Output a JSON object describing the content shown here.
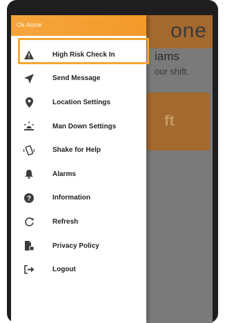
{
  "app": {
    "title_partial": "one",
    "heading_partial": "iams",
    "subtitle_partial": "our shift.",
    "button_partial": "ft"
  },
  "drawer": {
    "header_title": "Ok Alone",
    "items": [
      {
        "label": "High Risk Check In",
        "icon": "warning-icon",
        "selected": true
      },
      {
        "label": "Send Message",
        "icon": "send-icon"
      },
      {
        "label": "Location Settings",
        "icon": "location-pin-icon"
      },
      {
        "label": "Man Down Settings",
        "icon": "man-down-icon"
      },
      {
        "label": "Shake for Help",
        "icon": "shake-phone-icon"
      },
      {
        "label": "Alarms",
        "icon": "bell-icon"
      },
      {
        "label": "Information",
        "icon": "help-circle-icon"
      },
      {
        "label": "Refresh",
        "icon": "refresh-icon"
      },
      {
        "label": "Privacy Policy",
        "icon": "privacy-file-icon"
      },
      {
        "label": "Logout",
        "icon": "logout-icon"
      }
    ]
  },
  "colors": {
    "accent": "#f5a53c",
    "icon": "#3d3d3d",
    "scrim": "#7a7a7a",
    "app_bar_dim": "#a3692f"
  }
}
